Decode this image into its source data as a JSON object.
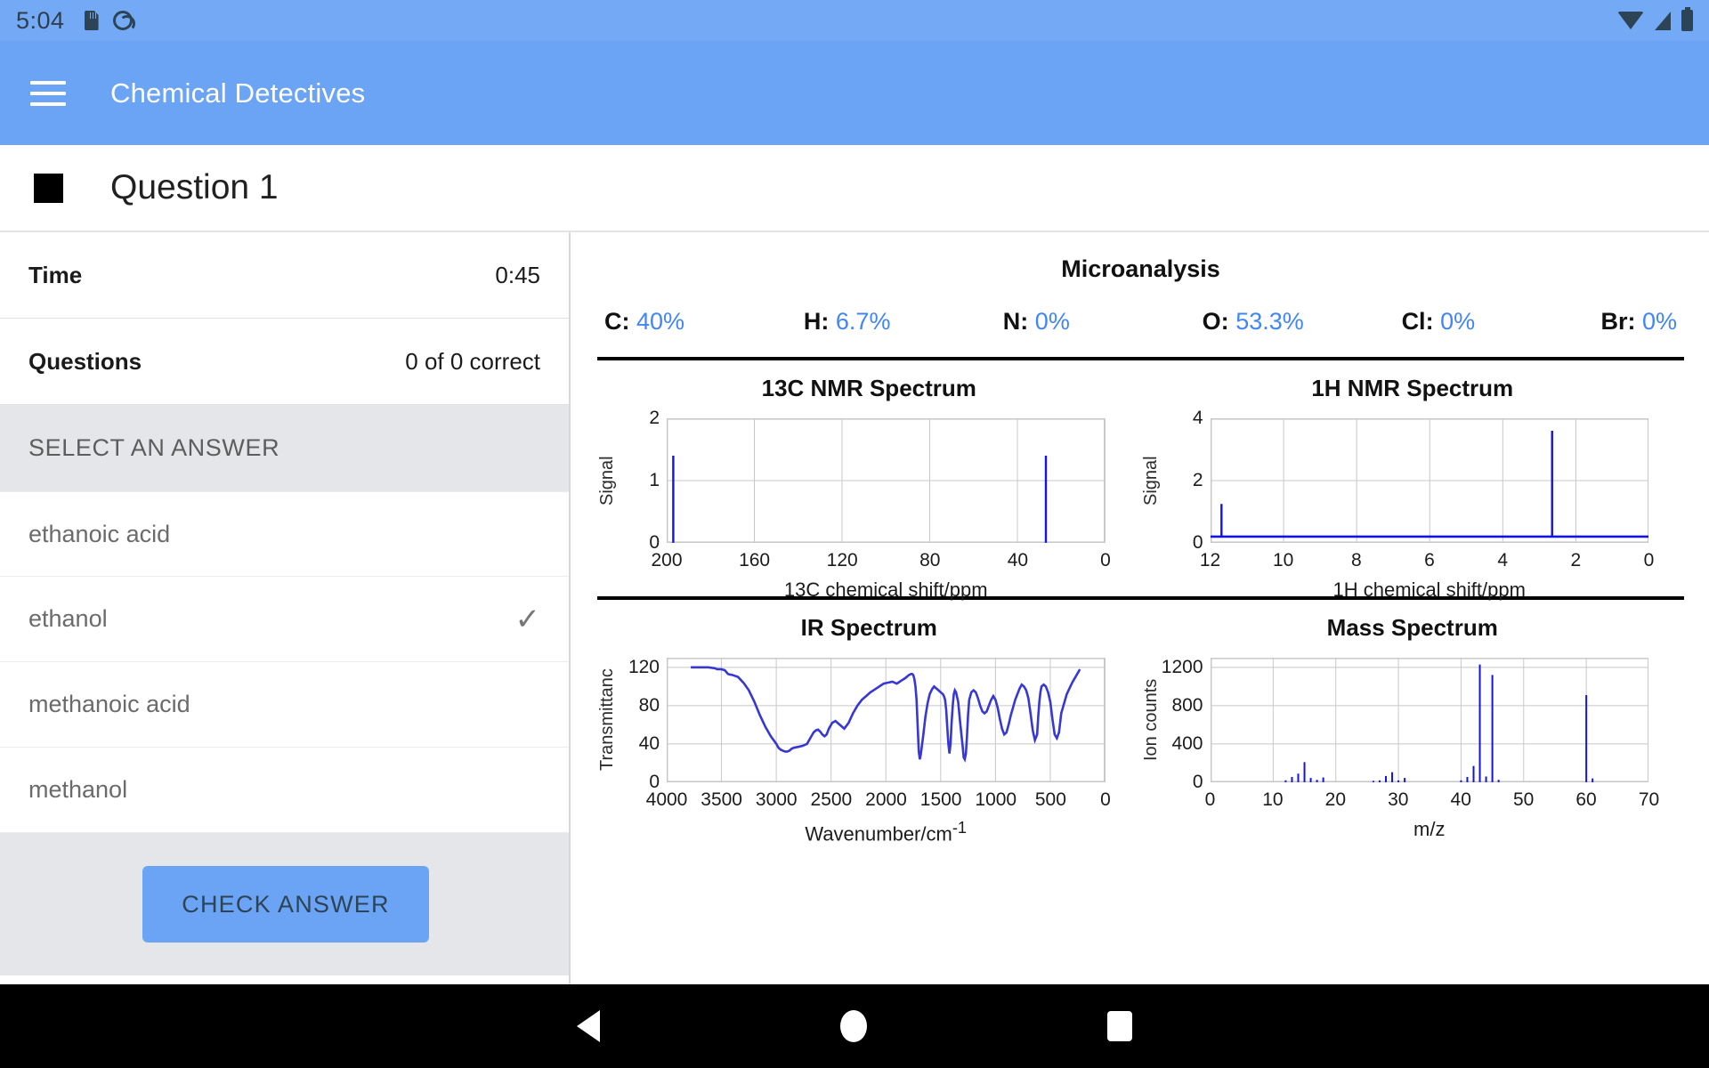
{
  "statusbar": {
    "clock": "5:04",
    "icons": [
      "sd-card-icon",
      "do-not-disturb-icon",
      "wifi-icon",
      "cell-signal-icon",
      "battery-icon"
    ]
  },
  "appbar": {
    "title": "Chemical Detectives",
    "menu_icon": "hamburger-menu-icon"
  },
  "question_header": {
    "title": "Question 1",
    "marker_icon": "stop-square-icon"
  },
  "sidebar": {
    "stats": [
      {
        "label": "Time",
        "value": "0:45"
      },
      {
        "label": "Questions",
        "value": "0 of 0 correct"
      }
    ],
    "select_header": "SELECT AN ANSWER",
    "answers": [
      {
        "label": "ethanoic acid",
        "selected": false
      },
      {
        "label": "ethanol",
        "selected": true
      },
      {
        "label": "methanoic acid",
        "selected": false
      },
      {
        "label": "methanol",
        "selected": false
      }
    ],
    "check_button": "CHECK ANSWER"
  },
  "microanalysis": {
    "title": "Microanalysis",
    "elements": [
      {
        "symbol": "C:",
        "percent": "40%"
      },
      {
        "symbol": "H:",
        "percent": "6.7%"
      },
      {
        "symbol": "N:",
        "percent": "0%"
      },
      {
        "symbol": "O:",
        "percent": "53.3%"
      },
      {
        "symbol": "Cl:",
        "percent": "0%"
      },
      {
        "symbol": "Br:",
        "percent": "0%"
      }
    ],
    "accent_color": "#4285f4"
  },
  "chart_data": [
    {
      "id": "c13nmr",
      "type": "bar",
      "title": "13C NMR Spectrum",
      "xlabel": "13C chemical shift/ppm",
      "ylabel": "Signal",
      "xlim": [
        200,
        0
      ],
      "ylim": [
        0,
        2
      ],
      "xticks": [
        200,
        160,
        120,
        80,
        40,
        0
      ],
      "yticks": [
        0,
        1,
        2
      ],
      "grid": true,
      "series_color": "#1414dc",
      "x": [
        197,
        27
      ],
      "values": [
        1.4,
        1.4
      ]
    },
    {
      "id": "h1nmr",
      "type": "bar",
      "title": "1H NMR Spectrum",
      "xlabel": "1H chemical shift/ppm",
      "ylabel": "Signal",
      "xlim": [
        12,
        0
      ],
      "ylim": [
        0,
        4
      ],
      "xticks": [
        12,
        10,
        8,
        6,
        4,
        2,
        0
      ],
      "yticks": [
        0,
        2,
        4
      ],
      "grid": true,
      "series_color": "#1414dc",
      "baseline": 0.2,
      "x": [
        11.7,
        2.65
      ],
      "values": [
        1.25,
        3.6
      ]
    },
    {
      "id": "ir",
      "type": "line",
      "title": "IR Spectrum",
      "xlabel": "Wavenumber/cm-1",
      "ylabel": "Transmittanc",
      "xlim": [
        4000,
        0
      ],
      "ylim": [
        0,
        130
      ],
      "xticks": [
        4000,
        3500,
        3000,
        2500,
        2000,
        1500,
        1000,
        500,
        0
      ],
      "yticks": [
        0,
        40,
        80,
        120
      ],
      "grid": true,
      "series_color": "#3737d4",
      "x": [
        3780,
        3700,
        3620,
        3560,
        3540,
        3500,
        3470,
        3440,
        3400,
        3350,
        3300,
        3250,
        3200,
        3150,
        3100,
        3050,
        3000,
        2980,
        2960,
        2940,
        2920,
        2900,
        2880,
        2860,
        2840,
        2800,
        2760,
        2720,
        2700,
        2680,
        2660,
        2640,
        2620,
        2600,
        2580,
        2560,
        2540,
        2520,
        2490,
        2460,
        2420,
        2380,
        2340,
        2300,
        2260,
        2220,
        2180,
        2140,
        2100,
        2060,
        2020,
        1980,
        1940,
        1900,
        1860,
        1820,
        1790,
        1770,
        1760,
        1750,
        1740,
        1730,
        1720,
        1710,
        1700,
        1690,
        1680,
        1660,
        1640,
        1620,
        1600,
        1580,
        1560,
        1540,
        1520,
        1500,
        1480,
        1470,
        1460,
        1450,
        1440,
        1430,
        1420,
        1410,
        1400,
        1390,
        1380,
        1370,
        1360,
        1340,
        1320,
        1300,
        1290,
        1280,
        1270,
        1260,
        1250,
        1240,
        1220,
        1200,
        1180,
        1160,
        1140,
        1120,
        1100,
        1080,
        1060,
        1040,
        1020,
        1000,
        980,
        960,
        940,
        920,
        900,
        880,
        860,
        840,
        820,
        800,
        780,
        760,
        740,
        720,
        700,
        680,
        660,
        640,
        620,
        610,
        600,
        590,
        580,
        560,
        540,
        520,
        500,
        480,
        460,
        440,
        420,
        400,
        350,
        300,
        260,
        230
      ],
      "y": [
        120,
        120,
        120,
        119,
        118,
        118,
        117,
        113,
        112,
        110,
        104,
        96,
        84,
        70,
        58,
        48,
        40,
        36,
        34,
        33,
        32,
        32,
        33,
        35,
        36,
        37,
        38,
        40,
        44,
        48,
        52,
        54,
        55,
        53,
        50,
        48,
        50,
        56,
        62,
        64,
        60,
        56,
        62,
        72,
        80,
        86,
        90,
        94,
        97,
        100,
        103,
        104,
        105,
        103,
        106,
        109,
        112,
        113,
        113,
        112,
        108,
        100,
        86,
        60,
        32,
        24,
        30,
        48,
        68,
        82,
        92,
        97,
        100,
        98,
        96,
        94,
        92,
        90,
        86,
        76,
        58,
        40,
        30,
        40,
        62,
        80,
        92,
        96,
        94,
        84,
        60,
        38,
        26,
        24,
        30,
        48,
        70,
        86,
        94,
        96,
        94,
        88,
        80,
        74,
        72,
        74,
        80,
        86,
        90,
        86,
        78,
        66,
        56,
        50,
        52,
        60,
        70,
        78,
        86,
        92,
        98,
        102,
        100,
        96,
        88,
        72,
        54,
        44,
        50,
        68,
        84,
        94,
        100,
        102,
        100,
        94,
        84,
        66,
        50,
        46,
        52,
        72,
        92,
        104,
        112,
        118,
        120,
        118,
        112,
        104,
        96,
        92
      ],
      "y_units": "%T"
    },
    {
      "id": "ms",
      "type": "bar",
      "title": "Mass Spectrum",
      "xlabel": "m/z",
      "ylabel": "Ion counts",
      "xlim": [
        0,
        70
      ],
      "ylim": [
        0,
        1300
      ],
      "xticks": [
        0,
        10,
        20,
        30,
        40,
        50,
        60,
        70
      ],
      "yticks": [
        0,
        400,
        800,
        1200
      ],
      "grid": true,
      "series_color": "#1414dc",
      "x": [
        12,
        13,
        14,
        15,
        16,
        17,
        18,
        26,
        27,
        28,
        29,
        30,
        31,
        40,
        41,
        42,
        43,
        44,
        45,
        46,
        60,
        61
      ],
      "values": [
        20,
        55,
        90,
        210,
        45,
        25,
        50,
        15,
        20,
        65,
        105,
        20,
        45,
        20,
        55,
        170,
        1230,
        60,
        1120,
        25,
        910,
        40
      ]
    }
  ],
  "navbar": {
    "back_icon": "nav-back-icon",
    "home_icon": "nav-home-icon",
    "recents_icon": "nav-recents-icon"
  }
}
